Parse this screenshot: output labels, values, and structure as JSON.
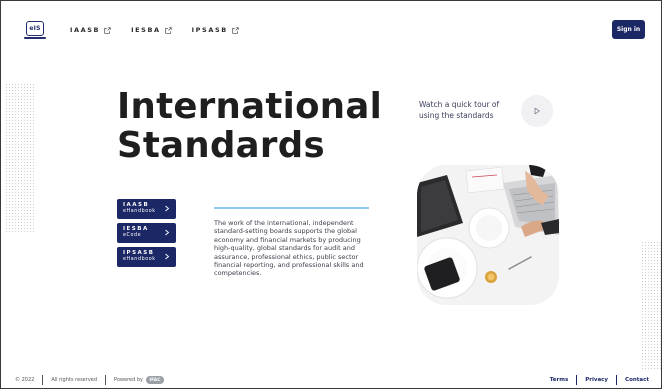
{
  "header": {
    "logo_text": "eIS",
    "nav": [
      {
        "label": "IAASB"
      },
      {
        "label": "IESBA"
      },
      {
        "label": "IPSASB"
      }
    ],
    "sign_in_label": "Sign in"
  },
  "hero": {
    "title_line1": "International",
    "title_line2": "Standards",
    "tour_text": "Watch a quick tour of using the standards"
  },
  "handbooks": [
    {
      "title": "IAASB",
      "subtitle": "eHandbook"
    },
    {
      "title": "IESBA",
      "subtitle": "eCode"
    },
    {
      "title": "IPSASB",
      "subtitle": "eHandbook"
    }
  ],
  "description": "The work of the international, independent standard-setting boards supports the global economy and financial markets by producing high-quality, global standards for audit and assurance, professional ethics, public sector financial reporting, and professional skills and competencies.",
  "footer": {
    "copyright": "© 2022",
    "rights": "All rights reserved",
    "powered_by": "Powered by",
    "powered_badge": "IFAC",
    "links": [
      {
        "label": "Terms"
      },
      {
        "label": "Privacy"
      },
      {
        "label": "Contact"
      }
    ]
  },
  "colors": {
    "brand_navy": "#1c2766",
    "accent_light_blue": "#8fc7ef"
  }
}
